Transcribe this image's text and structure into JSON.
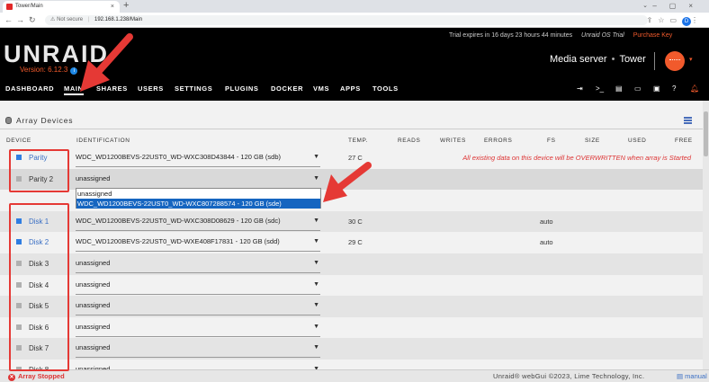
{
  "browser": {
    "tab_title": "Tower/Main",
    "not_secure": "Not secure",
    "url": "192.168.1.238/Main",
    "profile_letter": "D"
  },
  "header": {
    "logo": "UNRAID",
    "version": "Version: 6.12.3",
    "trial_text": "Trial expires in 16 days 23 hours 44 minutes",
    "os_label": "Unraid OS Trial",
    "purchase_key": "Purchase Key",
    "server_description": "Media server",
    "server_name": "Tower",
    "accent_color": "#f15a2c"
  },
  "menu": {
    "items": [
      "DASHBOARD",
      "MAIN",
      "SHARES",
      "USERS",
      "SETTINGS",
      "PLUGINS",
      "DOCKER",
      "VMS",
      "APPS",
      "TOOLS"
    ],
    "active": "MAIN",
    "icons": [
      "logout-icon",
      "terminal-icon",
      "feedback-icon",
      "monitor-icon",
      "info-icon",
      "help-icon",
      "bell-icon"
    ]
  },
  "array": {
    "title": "Array Devices",
    "columns": [
      "DEVICE",
      "IDENTIFICATION",
      "TEMP.",
      "READS",
      "WRITES",
      "ERRORS",
      "FS",
      "SIZE",
      "USED",
      "FREE"
    ],
    "warning": "All existing data on this device will be OVERWRITTEN when array is Started",
    "rows": [
      {
        "device": "Parity",
        "identification": "WDC_WD1200BEVS-22UST0_WD-WXC308D43844 - 120 GB (sdb)",
        "temp": "27 C",
        "fs": ""
      },
      {
        "device": "Parity 2",
        "identification": "unassigned",
        "temp": "",
        "fs": ""
      },
      {
        "device": "",
        "identification": "",
        "temp": "",
        "fs": ""
      },
      {
        "device": "Disk 1",
        "identification": "WDC_WD1200BEVS-22UST0_WD-WXC308D08629 - 120 GB (sdc)",
        "temp": "30 C",
        "fs": "auto"
      },
      {
        "device": "Disk 2",
        "identification": "WDC_WD1200BEVS-22UST0_WD-WXE408F17831 - 120 GB (sdd)",
        "temp": "29 C",
        "fs": "auto"
      },
      {
        "device": "Disk 3",
        "identification": "unassigned",
        "temp": "",
        "fs": ""
      },
      {
        "device": "Disk 4",
        "identification": "unassigned",
        "temp": "",
        "fs": ""
      },
      {
        "device": "Disk 5",
        "identification": "unassigned",
        "temp": "",
        "fs": ""
      },
      {
        "device": "Disk 6",
        "identification": "unassigned",
        "temp": "",
        "fs": ""
      },
      {
        "device": "Disk 7",
        "identification": "unassigned",
        "temp": "",
        "fs": ""
      },
      {
        "device": "Disk 8",
        "identification": "unassigned",
        "temp": "",
        "fs": ""
      }
    ],
    "dropdown_options": [
      "unassigned",
      "WDC_WD1200BEVS-22UST0_WD-WXC807288574 - 120 GB (sde)"
    ],
    "dropdown_highlighted": 1
  },
  "footer": {
    "status": "Array Stopped",
    "copyright": "Unraid® webGui ©2023, Lime Technology, Inc.",
    "manual": "manual"
  },
  "annotation_color": "#e53935"
}
